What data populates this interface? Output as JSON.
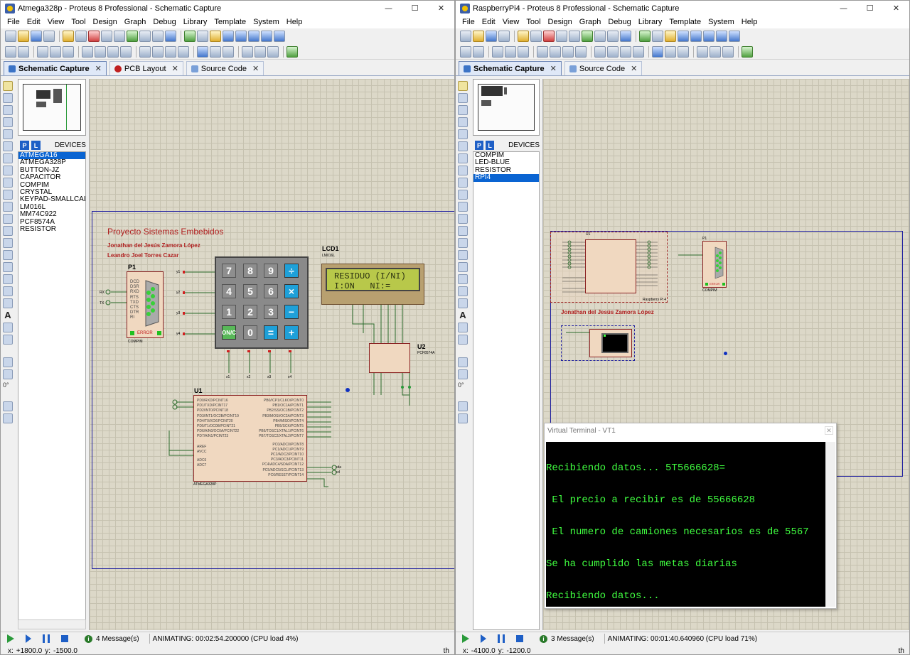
{
  "left": {
    "window_title": "Atmega328p - Proteus 8 Professional - Schematic Capture",
    "menu": [
      "File",
      "Edit",
      "View",
      "Tool",
      "Design",
      "Graph",
      "Debug",
      "Library",
      "Template",
      "System",
      "Help"
    ],
    "tabs": [
      {
        "label": "Schematic Capture",
        "active": true
      },
      {
        "label": "PCB Layout",
        "active": false
      },
      {
        "label": "Source Code",
        "active": false
      }
    ],
    "devices_title": "DEVICES",
    "devices": [
      "ATMEGA16",
      "ATMEGA328P",
      "BUTTON-JZ",
      "CAPACITOR",
      "COMPIM",
      "CRYSTAL",
      "KEYPAD-SMALLCALC",
      "LM016L",
      "MM74C922",
      "PCF8574A",
      "RESISTOR"
    ],
    "selected_device": "ATMEGA16",
    "rotation": "0°",
    "schematic": {
      "title": "Proyecto Sistemas Embebidos",
      "author1": "Jonathan del Jesús Zamora López",
      "author2": "Leandro Joel Torres Cazar",
      "p1_label": "P1",
      "p1_part": "COMPIM",
      "p1_pins": [
        "DCD",
        "DSR",
        "RXD",
        "RTS",
        "TXD",
        "CTS",
        "DTR",
        "RI"
      ],
      "p1_error": "ERROR",
      "rx": "RX",
      "tx": "TX",
      "lcd_label": "LCD1",
      "lcd_part": "LM016L",
      "lcd_line1": "RESIDUO (I/NI)",
      "lcd_line2": "I:ON   NI:=",
      "u2_label": "U2",
      "u2_part": "PCF8574A",
      "u1_label": "U1",
      "u1_part": "ATMEGA328P",
      "keys": [
        [
          "7",
          "8",
          "9",
          "÷"
        ],
        [
          "4",
          "5",
          "6",
          "×"
        ],
        [
          "1",
          "2",
          "3",
          "−"
        ],
        [
          "ON/C",
          "0",
          "=",
          "+"
        ]
      ],
      "row_labels": [
        "y1",
        "y2",
        "y3",
        "y4"
      ],
      "col_labels": [
        "x1",
        "x2",
        "x3",
        "x4"
      ],
      "u1_pins_left": [
        "PD0/RXD/PCINT16",
        "PD1/TXD/PCINT17",
        "PD2/INT0/PCINT18",
        "PD3/INT1/OC2B/PCINT19",
        "PD4/T0/XCK/PCINT20",
        "PD5/T1/OC0B/PCINT21",
        "PD6/AIN0/OC0A/PCINT22",
        "PD7/AIN1/PCINT23",
        "AREF",
        "AVCC",
        "ADC6",
        "ADC7"
      ],
      "u1_pins_right": [
        "PB0/ICP1/CLKO/PCINT0",
        "PB1/OC1A/PCINT1",
        "PB2/SS/OC1B/PCINT2",
        "PB3/MOSI/OC2A/PCINT3",
        "PB4/MISO/PCINT4",
        "PB5/SCK/PCINT5",
        "PB6/TOSC1/XTAL1/PCINT6",
        "PB7/TOSC2/XTAL2/PCINT7",
        "PC0/ADC0/PCINT8",
        "PC1/ADC1/PCINT9",
        "PC2/ADC2/PCINT10",
        "PC3/ADC3/PCINT11",
        "PC4/ADC4/SDA/PCINT12",
        "PC5/ADC5/SCL/PCINT13",
        "PC6/RESET/PCINT14"
      ],
      "sda": "sda",
      "scl": "scl"
    },
    "status": {
      "messages": "4 Message(s)",
      "animating": "ANIMATING: 00:02:54.200000 (CPU load 4%)",
      "x_label": "x:",
      "x_value": "+1800.0",
      "y_label": "y:",
      "y_value": "-1500.0",
      "th": "th"
    }
  },
  "right": {
    "window_title": "RaspberryPi4 - Proteus 8 Professional - Schematic Capture",
    "menu": [
      "File",
      "Edit",
      "View",
      "Tool",
      "Design",
      "Graph",
      "Debug",
      "Library",
      "Template",
      "System",
      "Help"
    ],
    "tabs": [
      {
        "label": "Schematic Capture",
        "active": true
      },
      {
        "label": "Source Code",
        "active": false
      }
    ],
    "devices_title": "DEVICES",
    "devices": [
      "COMPIM",
      "LED-BLUE",
      "RESISTOR",
      "RPI4"
    ],
    "selected_device": "RPI4",
    "rotation": "0°",
    "schematic": {
      "author": "Jonathan del Jesús Zamora López",
      "u1_label": "U1",
      "u1_part": "Raspberry Pi 4",
      "p1_label": "P1",
      "p1_part": "COMPIM",
      "p1_error": "ERROR"
    },
    "terminal": {
      "title": "Virtual Terminal - VT1",
      "lines": [
        "Recibiendo datos... 5T5666628=",
        " El precio a recibir es de 55666628",
        " El numero de camiones necesarios es de 5567",
        "Se ha cumplido las metas diarias",
        "Recibiendo datos..."
      ]
    },
    "status": {
      "messages": "3 Message(s)",
      "animating": "ANIMATING: 00:01:40.640960 (CPU load 71%)",
      "x_label": "x:",
      "x_value": "-4100.0",
      "y_label": "y:",
      "y_value": "-1200.0",
      "th": "th"
    }
  },
  "colors": {
    "schematic_bg": "#dcd8c8",
    "grid": "#c6c2b0",
    "terminal_text": "#40ff40",
    "selection": "#0a64d2",
    "title_red": "#b02020"
  }
}
